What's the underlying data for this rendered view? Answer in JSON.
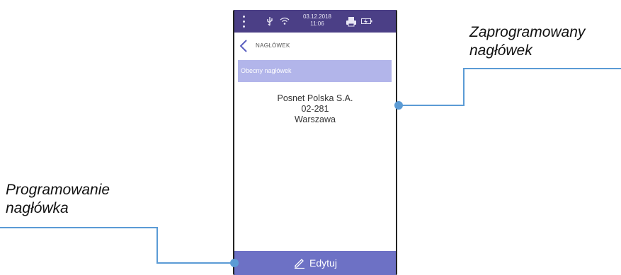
{
  "callouts": {
    "right": {
      "line1": "Zaprogramowany",
      "line2": "nagłówek"
    },
    "left": {
      "line1": "Programowanie",
      "line2": "nagłówka"
    }
  },
  "status_bar": {
    "date": "03.12.2018",
    "time": "11:06",
    "icons": [
      "menu-dots-icon",
      "usb-icon",
      "wifi-icon",
      "printer-icon",
      "battery-icon"
    ]
  },
  "screen": {
    "title": "NAGŁÓWEK",
    "section_label": "Obecny nagłówek",
    "header_lines": [
      "Posnet Polska S.A.",
      "02-281",
      "Warszawa"
    ],
    "edit_button_label": "Edytuj"
  },
  "colors": {
    "status_bar": "#4b3f86",
    "section_bar": "#b2b5ea",
    "edit_button": "#6d71c5",
    "callout_line": "#5b9bd5"
  }
}
